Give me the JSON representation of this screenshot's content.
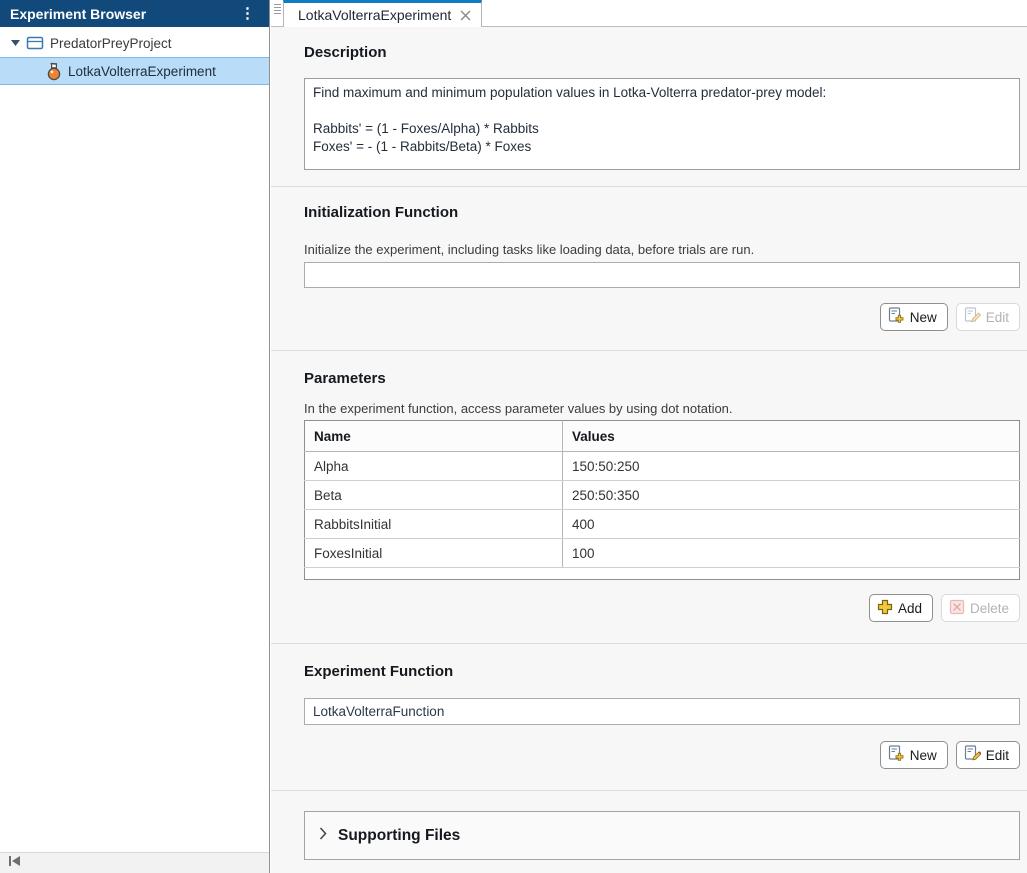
{
  "colors": {
    "sidebar_header_bg": "#11497b",
    "selection_bg": "#b9dcf8",
    "tab_accent": "#0f7bc4",
    "icon_flask_orange": "#f08232",
    "icon_plus_yellow": "#f2ca3c",
    "icon_delete_red": "#d06060"
  },
  "sidebar": {
    "title": "Experiment Browser",
    "tree": {
      "project": "PredatorPreyProject",
      "experiment": "LotkaVolterraExperiment"
    }
  },
  "tab": {
    "label": "LotkaVolterraExperiment"
  },
  "sections": {
    "description": {
      "title": "Description",
      "text": "Find maximum and minimum population values in Lotka-Volterra predator-prey model:\n\nRabbits' = (1 - Foxes/Alpha) * Rabbits\nFoxes' = - (1 - Rabbits/Beta) * Foxes"
    },
    "initialization": {
      "title": "Initialization Function",
      "help": "Initialize the experiment, including tasks like loading data, before trials are run.",
      "value": "",
      "new_label": "New",
      "edit_label": "Edit"
    },
    "parameters": {
      "title": "Parameters",
      "help": "In the experiment function, access parameter values by using dot notation.",
      "columns": [
        "Name",
        "Values"
      ],
      "rows": [
        {
          "name": "Alpha",
          "values": "150:50:250"
        },
        {
          "name": "Beta",
          "values": "250:50:350"
        },
        {
          "name": "RabbitsInitial",
          "values": "400"
        },
        {
          "name": "FoxesInitial",
          "values": "100"
        }
      ],
      "add_label": "Add",
      "delete_label": "Delete"
    },
    "experiment_function": {
      "title": "Experiment Function",
      "value": "LotkaVolterraFunction",
      "new_label": "New",
      "edit_label": "Edit"
    },
    "supporting_files": {
      "title": "Supporting Files"
    }
  }
}
